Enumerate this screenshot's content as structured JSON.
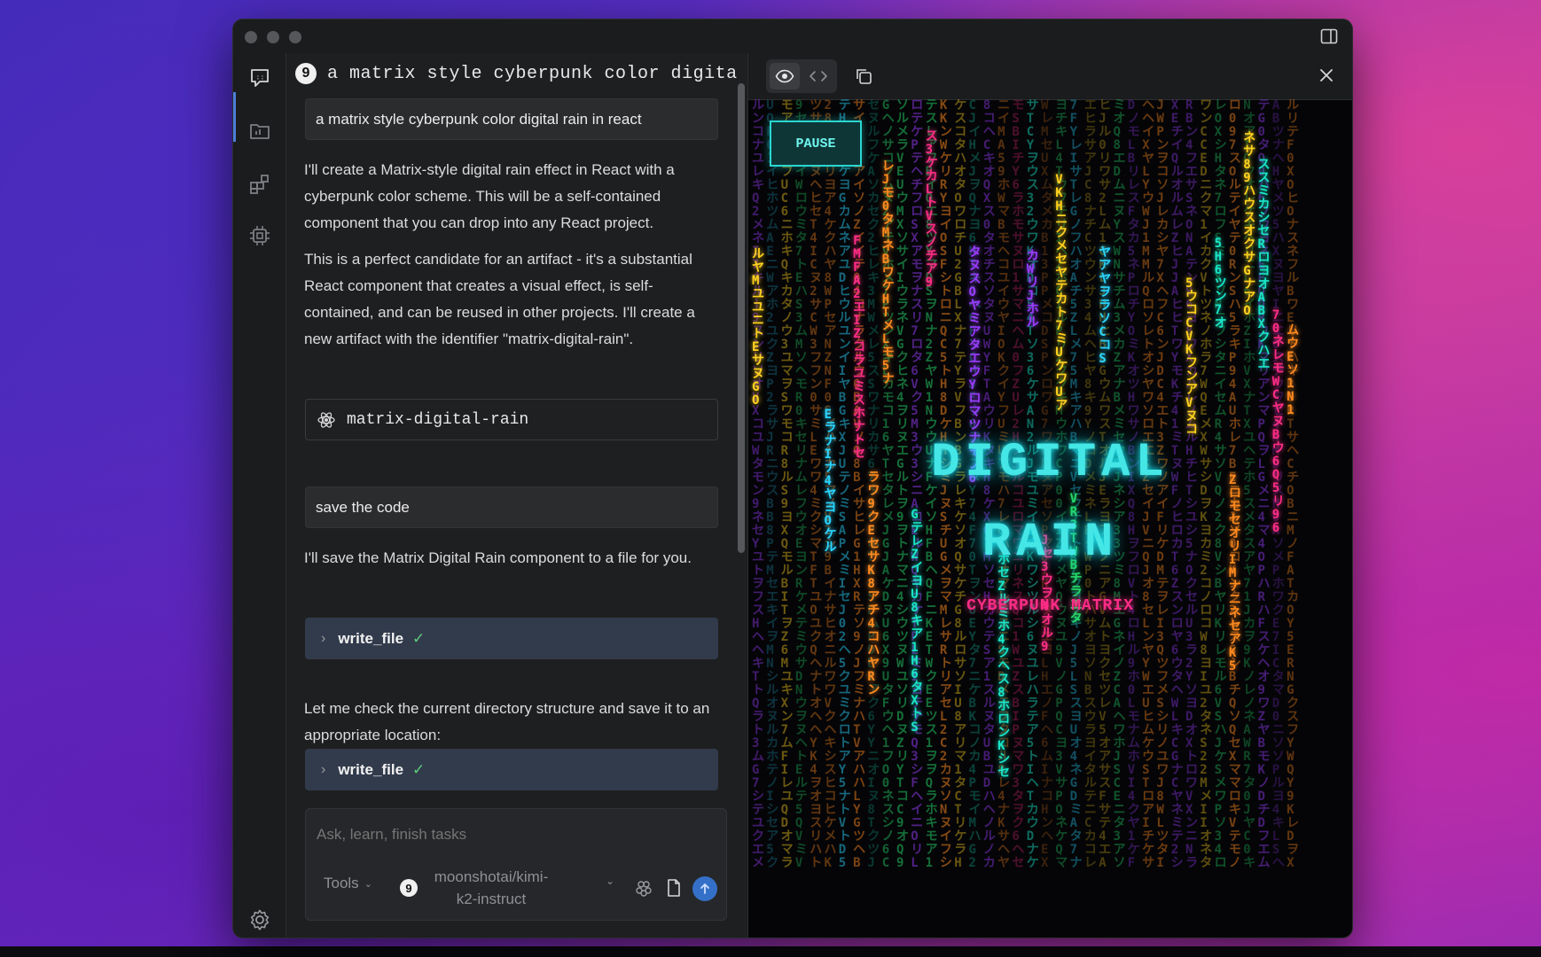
{
  "chat": {
    "badge": "9",
    "title": "a matrix style cyberpunk color digital rain in react",
    "messages": {
      "user1": "a matrix style cyberpunk color digital rain in react",
      "assistant1_p1": "I'll create a Matrix-style digital rain effect in React with a cyberpunk color scheme. This will be a self-contained component that you can drop into any React project.",
      "assistant1_p2": "This is a perfect candidate for an artifact - it's a substantial React component that creates a visual effect, is self-contained, and can be reused in other projects. I'll create a new artifact with the identifier \"matrix-digital-rain\".",
      "artifact": "matrix-digital-rain",
      "user2": "save the code",
      "assistant2_p1": "I'll save the Matrix Digital Rain component to a file for you.",
      "tool1": "write_file",
      "assistant2_p2": "Let me check the current directory structure and save it to an appropriate location:",
      "tool2": "write_file"
    },
    "composer": {
      "placeholder": "Ask, learn, finish tasks",
      "tools_label": "Tools",
      "model_badge": "9",
      "model": "moonshotai/kimi-k2-instruct"
    }
  },
  "preview": {
    "pause_label": "PAUSE",
    "title_line1": "DIGITAL",
    "title_line2": "RAIN",
    "subtitle": "CYBERPUNK MATRIX"
  },
  "colors": {
    "accent": "#3570c8",
    "tool_bg": "#323b4c",
    "rain": [
      "#19e6c8",
      "#ff2d86",
      "#2ad6ff",
      "#ff8a1f",
      "#9a3cff",
      "#25d96b",
      "#ffd21f"
    ]
  }
}
